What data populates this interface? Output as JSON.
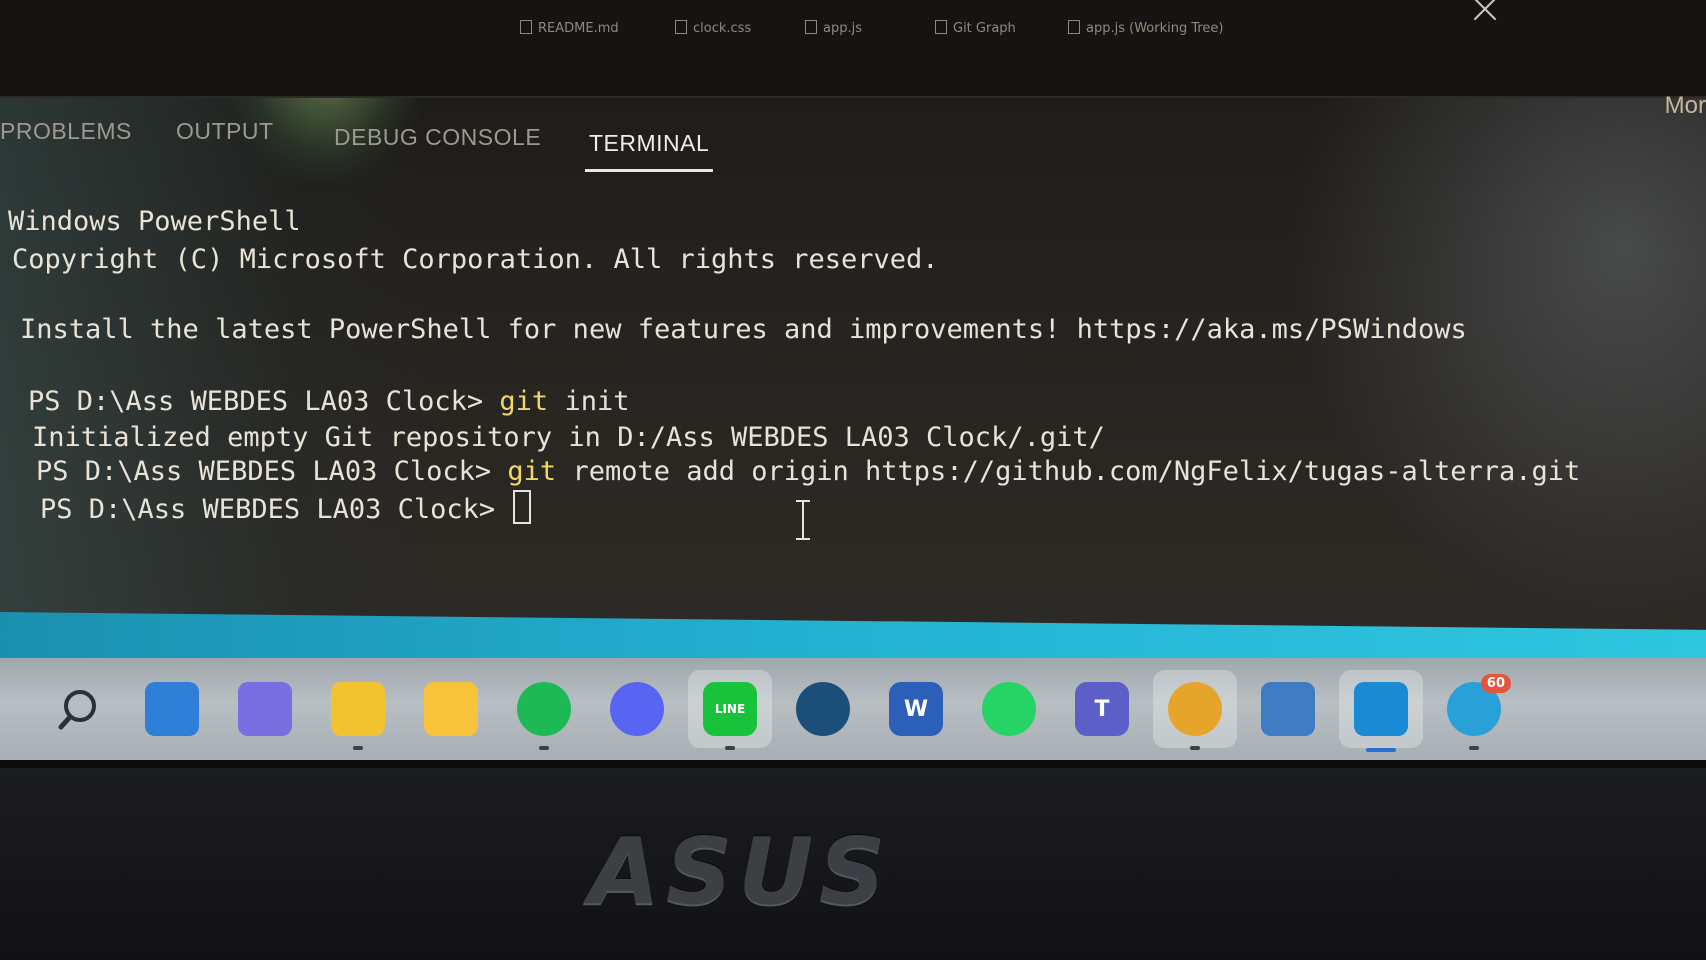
{
  "editor_tabs": [
    {
      "label": "README.md"
    },
    {
      "label": "clock.css"
    },
    {
      "label": "app.js"
    },
    {
      "label": "Git Graph"
    },
    {
      "label": "app.js (Working Tree)"
    }
  ],
  "panel": {
    "tabs": [
      "PROBLEMS",
      "OUTPUT",
      "DEBUG CONSOLE",
      "TERMINAL"
    ],
    "active_tab": "TERMINAL",
    "more_label": "Mor"
  },
  "terminal": {
    "lines": [
      {
        "text": "Windows PowerShell"
      },
      {
        "text": "Copyright (C) Microsoft Corporation. All rights reserved."
      },
      {
        "text": "Install the latest PowerShell for new features and improvements! https://aka.ms/PSWindows"
      },
      {
        "prompt": "PS D:\\Ass WEBDES LA03 Clock> ",
        "cmd": "git",
        "args": " init"
      },
      {
        "text": "Initialized empty Git repository in D:/Ass WEBDES LA03 Clock/.git/"
      },
      {
        "prompt": "PS D:\\Ass WEBDES LA03 Clock> ",
        "cmd": "git",
        "args": " remote add origin https://github.com/NgFelix/tugas-alterra.git"
      },
      {
        "prompt": "PS D:\\Ass WEBDES LA03 Clock> "
      }
    ]
  },
  "taskbar": {
    "icons": [
      {
        "name": "search-icon",
        "color": "#2b3540"
      },
      {
        "name": "widgets-icon",
        "color": "#2f7fd8"
      },
      {
        "name": "chat-icon",
        "color": "#7b6ee0"
      },
      {
        "name": "file-explorer-icon",
        "color": "#f2c230"
      },
      {
        "name": "sticky-notes-icon",
        "color": "#f6c33a"
      },
      {
        "name": "spotify-icon",
        "color": "#1db954"
      },
      {
        "name": "discord-icon",
        "color": "#5865f2"
      },
      {
        "name": "line-icon",
        "color": "#19c23b",
        "label": "LINE"
      },
      {
        "name": "steam-icon",
        "color": "#1b4f7a"
      },
      {
        "name": "word-icon",
        "color": "#2b5fb8",
        "label": "W"
      },
      {
        "name": "whatsapp-icon",
        "color": "#25d366"
      },
      {
        "name": "teams-icon",
        "color": "#5b5fc7",
        "label": "T"
      },
      {
        "name": "chrome-icon",
        "color": "#e5a52a"
      },
      {
        "name": "remote-desktop-icon",
        "color": "#3f7cc4"
      },
      {
        "name": "vscode-icon",
        "color": "#1a8ad4"
      },
      {
        "name": "telegram-icon",
        "color": "#2aa0d8",
        "badge": "60"
      }
    ]
  },
  "brand": "ASUS"
}
